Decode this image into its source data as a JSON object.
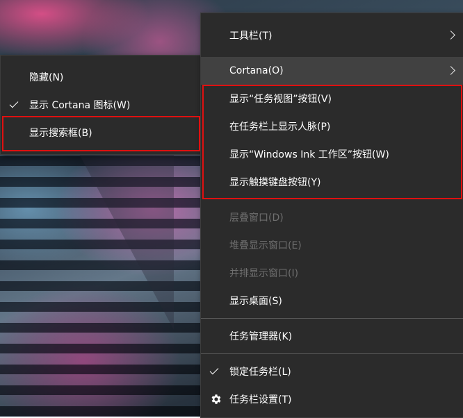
{
  "submenu": {
    "items": [
      {
        "label": "隐藏(N)",
        "checked": false
      },
      {
        "label": "显示 Cortana 图标(W)",
        "checked": true
      },
      {
        "label": "显示搜索框(B)",
        "checked": false
      }
    ]
  },
  "context_menu": {
    "toolbar": "工具栏(T)",
    "cortana": "Cortana(O)",
    "show_task_view": "显示“任务视图”按钮(V)",
    "show_people": "在任务栏上显示人脉(P)",
    "show_windows_ink": "显示“Windows Ink 工作区”按钮(W)",
    "show_touch_keyboard": "显示触摸键盘按钮(Y)",
    "cascade_windows": "层叠窗口(D)",
    "stack_windows": "堆叠显示窗口(E)",
    "side_by_side": "并排显示窗口(I)",
    "show_desktop": "显示桌面(S)",
    "task_manager": "任务管理器(K)",
    "lock_taskbar": "锁定任务栏(L)",
    "taskbar_settings": "任务栏设置(T)"
  },
  "colors": {
    "menu_background": "#2b2b2b",
    "hover_background": "#414141",
    "disabled_text": "#6f6f6f",
    "highlight_box": "#e01010"
  }
}
